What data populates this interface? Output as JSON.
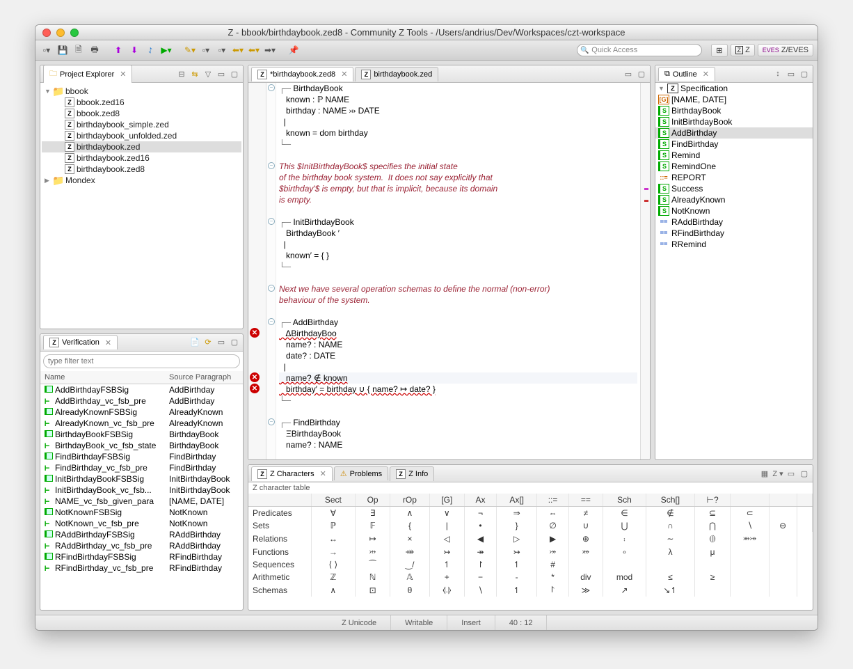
{
  "window": {
    "title": "Z - bbook/birthdaybook.zed8 - Community Z Tools - /Users/andrius/Dev/Workspaces/czt-workspace"
  },
  "toolbar": {
    "quick_access_placeholder": "Quick Access",
    "persp_z": "Z",
    "persp_zeves": "Z/EVES"
  },
  "project_explorer": {
    "title": "Project Explorer",
    "root": "bbook",
    "files": [
      "bbook.zed16",
      "bbook.zed8",
      "birthdaybook_simple.zed",
      "birthdaybook_unfolded.zed",
      "birthdaybook.zed",
      "birthdaybook.zed16",
      "birthdaybook.zed8"
    ],
    "selected": "birthdaybook.zed",
    "other_root": "Mondex"
  },
  "verification": {
    "title": "Verification",
    "filter_placeholder": "type filter text",
    "columns": {
      "name": "Name",
      "src": "Source Paragraph"
    },
    "rows": [
      {
        "icon": "s",
        "name": "AddBirthdayFSBSig",
        "src": "AddBirthday"
      },
      {
        "icon": "t",
        "name": "AddBirthday_vc_fsb_pre",
        "src": "AddBirthday"
      },
      {
        "icon": "s",
        "name": "AlreadyKnownFSBSig",
        "src": "AlreadyKnown"
      },
      {
        "icon": "t",
        "name": "AlreadyKnown_vc_fsb_pre",
        "src": "AlreadyKnown"
      },
      {
        "icon": "s",
        "name": "BirthdayBookFSBSig",
        "src": "BirthdayBook"
      },
      {
        "icon": "t",
        "name": "BirthdayBook_vc_fsb_state",
        "src": "BirthdayBook"
      },
      {
        "icon": "s",
        "name": "FindBirthdayFSBSig",
        "src": "FindBirthday"
      },
      {
        "icon": "t",
        "name": "FindBirthday_vc_fsb_pre",
        "src": "FindBirthday"
      },
      {
        "icon": "s",
        "name": "InitBirthdayBookFSBSig",
        "src": "InitBirthdayBook"
      },
      {
        "icon": "t",
        "name": "InitBirthdayBook_vc_fsb...",
        "src": "InitBirthdayBook"
      },
      {
        "icon": "t",
        "name": "NAME_vc_fsb_given_para",
        "src": "[NAME, DATE]"
      },
      {
        "icon": "s",
        "name": "NotKnownFSBSig",
        "src": "NotKnown"
      },
      {
        "icon": "t",
        "name": "NotKnown_vc_fsb_pre",
        "src": "NotKnown"
      },
      {
        "icon": "s",
        "name": "RAddBirthdayFSBSig",
        "src": "RAddBirthday"
      },
      {
        "icon": "t",
        "name": "RAddBirthday_vc_fsb_pre",
        "src": "RAddBirthday"
      },
      {
        "icon": "s",
        "name": "RFindBirthdayFSBSig",
        "src": "RFindBirthday"
      },
      {
        "icon": "t",
        "name": "RFindBirthday_vc_fsb_pre",
        "src": "RFindBirthday"
      }
    ]
  },
  "editor": {
    "tabs": [
      {
        "label": "*birthdaybook.zed8",
        "active": true,
        "closable": true
      },
      {
        "label": "birthdaybook.zed",
        "active": false,
        "closable": false
      }
    ],
    "lines": [
      {
        "fold": "-",
        "box": "┌─",
        "text": " BirthdayBook"
      },
      {
        "text": "   known : ℙ NAME"
      },
      {
        "text": "   birthday : NAME ⤔ DATE"
      },
      {
        "text": "  |"
      },
      {
        "text": "   known = dom birthday"
      },
      {
        "box": "└─",
        "text": ""
      },
      {
        "text": ""
      },
      {
        "fold": "-",
        "cmt": true,
        "text": "This $InitBirthdayBook$ specifies the initial state"
      },
      {
        "cmt": true,
        "text": "of the birthday book system.  It does not say explicitly that"
      },
      {
        "cmt": true,
        "text": "$birthday'$ is empty, but that is implicit, because its domain"
      },
      {
        "cmt": true,
        "text": "is empty."
      },
      {
        "text": ""
      },
      {
        "fold": "-",
        "box": "┌─",
        "text": " InitBirthdayBook"
      },
      {
        "text": "   BirthdayBook ′"
      },
      {
        "text": "  |"
      },
      {
        "text": "   known′ = { }"
      },
      {
        "box": "└─",
        "text": ""
      },
      {
        "text": ""
      },
      {
        "fold": "-",
        "cmt": true,
        "text": "Next we have several operation schemas to define the normal (non-error)"
      },
      {
        "cmt": true,
        "text": "behaviour of the system."
      },
      {
        "text": ""
      },
      {
        "fold": "-",
        "box": "┌─",
        "text": " AddBirthday"
      },
      {
        "err": true,
        "gut": "x",
        "text": "   ΔBirthdayBoo"
      },
      {
        "text": "   name? : NAME"
      },
      {
        "text": "   date? : DATE"
      },
      {
        "text": "  |"
      },
      {
        "err": true,
        "gut": "x",
        "hl": true,
        "text": "   name? ∉ known"
      },
      {
        "err": true,
        "gut": "x",
        "text": "   birthday′ = birthday ∪ { name? ↦ date? }"
      },
      {
        "box": "└─",
        "text": ""
      },
      {
        "text": ""
      },
      {
        "fold": "-",
        "box": "┌─",
        "text": " FindBirthday"
      },
      {
        "text": "   ΞBirthdayBook"
      },
      {
        "text": "   name? : NAME"
      }
    ]
  },
  "outline": {
    "title": "Outline",
    "root": "Specification",
    "items": [
      {
        "icon": "g",
        "label": "[NAME, DATE]"
      },
      {
        "icon": "s",
        "label": "BirthdayBook"
      },
      {
        "icon": "s",
        "label": "InitBirthdayBook"
      },
      {
        "icon": "s",
        "label": "AddBirthday",
        "sel": true
      },
      {
        "icon": "s",
        "label": "FindBirthday"
      },
      {
        "icon": "s",
        "label": "Remind"
      },
      {
        "icon": "s",
        "label": "RemindOne"
      },
      {
        "icon": "f",
        "label": "REPORT"
      },
      {
        "icon": "s",
        "label": "Success"
      },
      {
        "icon": "s",
        "label": "AlreadyKnown"
      },
      {
        "icon": "s",
        "label": "NotKnown"
      },
      {
        "icon": "eq",
        "label": "RAddBirthday"
      },
      {
        "icon": "eq",
        "label": "RFindBirthday"
      },
      {
        "icon": "eq",
        "label": "RRemind"
      }
    ]
  },
  "z_char": {
    "tabs": [
      {
        "label": "Z Characters",
        "active": true
      },
      {
        "label": "Problems",
        "active": false
      },
      {
        "label": "Z Info",
        "active": false
      }
    ],
    "table_label": "Z character table",
    "headers": [
      "",
      "Sect",
      "Op",
      "rOp",
      "[G]",
      "Ax",
      "Ax[]",
      "::=",
      "==",
      "Sch",
      "Sch[]",
      "⊢?",
      "",
      "",
      ""
    ],
    "rows": [
      {
        "h": "Predicates",
        "c": [
          "∀",
          "∃",
          "∧",
          "∨",
          "¬",
          "⇒",
          "⇔",
          "≠",
          "∈",
          "∉",
          "⊆",
          "⊂",
          "",
          ""
        ]
      },
      {
        "h": "Sets",
        "c": [
          "ℙ",
          "𝔽",
          "{",
          "|",
          "•",
          "}",
          "∅",
          "∪",
          "⋃",
          "∩",
          "⋂",
          "∖",
          "⊖",
          ""
        ]
      },
      {
        "h": "Relations",
        "c": [
          "↔",
          "↦",
          "×",
          "◁",
          "◀",
          "▷",
          "▶",
          "⊕",
          "⨾",
          "∼",
          "⦇⦈",
          "⤕⤖",
          ""
        ]
      },
      {
        "h": "Functions",
        "c": [
          "→",
          "⤔",
          "⤀",
          "↣",
          "↠",
          "↣",
          "⤖",
          "⤗",
          "∘",
          "λ",
          "μ",
          "",
          ""
        ]
      },
      {
        "h": "Sequences",
        "c": [
          "⟨ ⟩",
          "⁀",
          "‿/",
          "↿",
          "↾",
          "↿",
          "#",
          "",
          "",
          "",
          "",
          "",
          ""
        ]
      },
      {
        "h": "Arithmetic",
        "c": [
          "ℤ",
          "ℕ",
          "𝔸",
          "+",
          "−",
          "-",
          "*",
          "div",
          "mod",
          "≤",
          "≥",
          "",
          ""
        ]
      },
      {
        "h": "Schemas",
        "c": [
          "∧",
          "⊡",
          "θ",
          "⦉.⦊",
          "∖",
          "↿",
          "⨡",
          "≫",
          "↗",
          "↘↿",
          "",
          "",
          ""
        ]
      }
    ],
    "menu_label": "Z"
  },
  "status": {
    "enc": "Z Unicode",
    "mode": "Writable",
    "ins": "Insert",
    "pos": "40 : 12"
  }
}
